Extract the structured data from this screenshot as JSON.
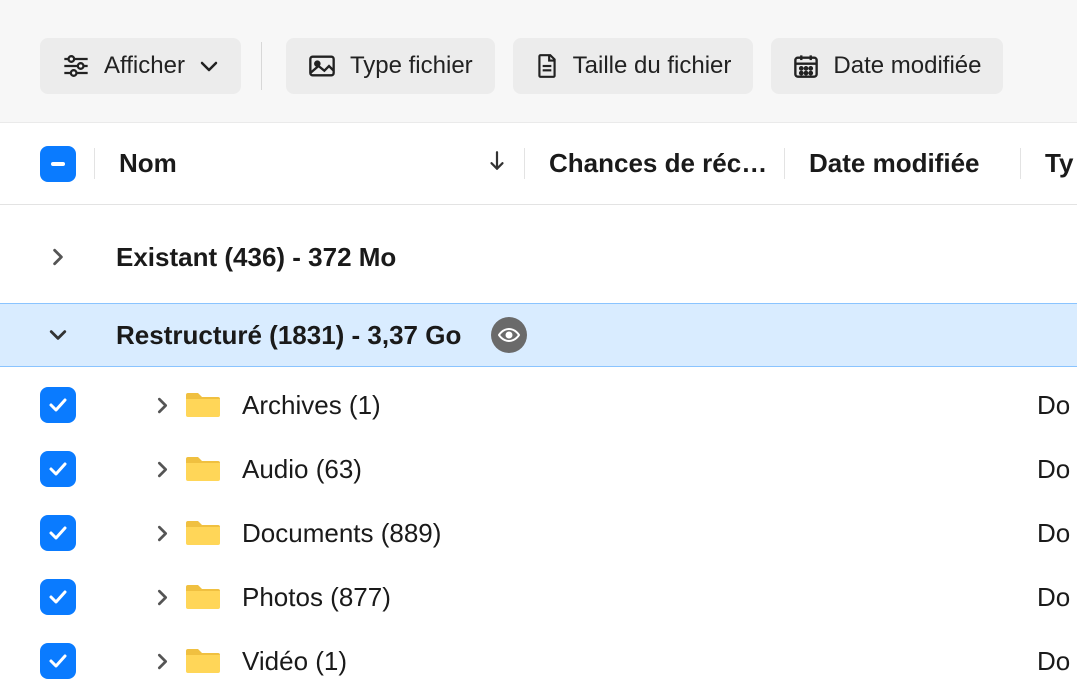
{
  "toolbar": {
    "display_label": "Afficher",
    "filters": [
      {
        "label": "Type fichier",
        "icon": "image"
      },
      {
        "label": "Taille du fichier",
        "icon": "file"
      },
      {
        "label": "Date modifiée",
        "icon": "calendar"
      }
    ]
  },
  "columns": {
    "name": "Nom",
    "chances": "Chances de réc…",
    "date": "Date modifiée",
    "type": "Ty"
  },
  "groups": [
    {
      "label": "Existant (436) - 372 Mo",
      "expanded": false,
      "selected": false
    },
    {
      "label": "Restructuré (1831) - 3,37 Go",
      "expanded": true,
      "selected": true
    }
  ],
  "rows": [
    {
      "name": "Archives (1)",
      "type": "Do"
    },
    {
      "name": "Audio (63)",
      "type": "Do"
    },
    {
      "name": "Documents (889)",
      "type": "Do"
    },
    {
      "name": "Photos (877)",
      "type": "Do"
    },
    {
      "name": "Vidéo (1)",
      "type": "Do"
    }
  ]
}
